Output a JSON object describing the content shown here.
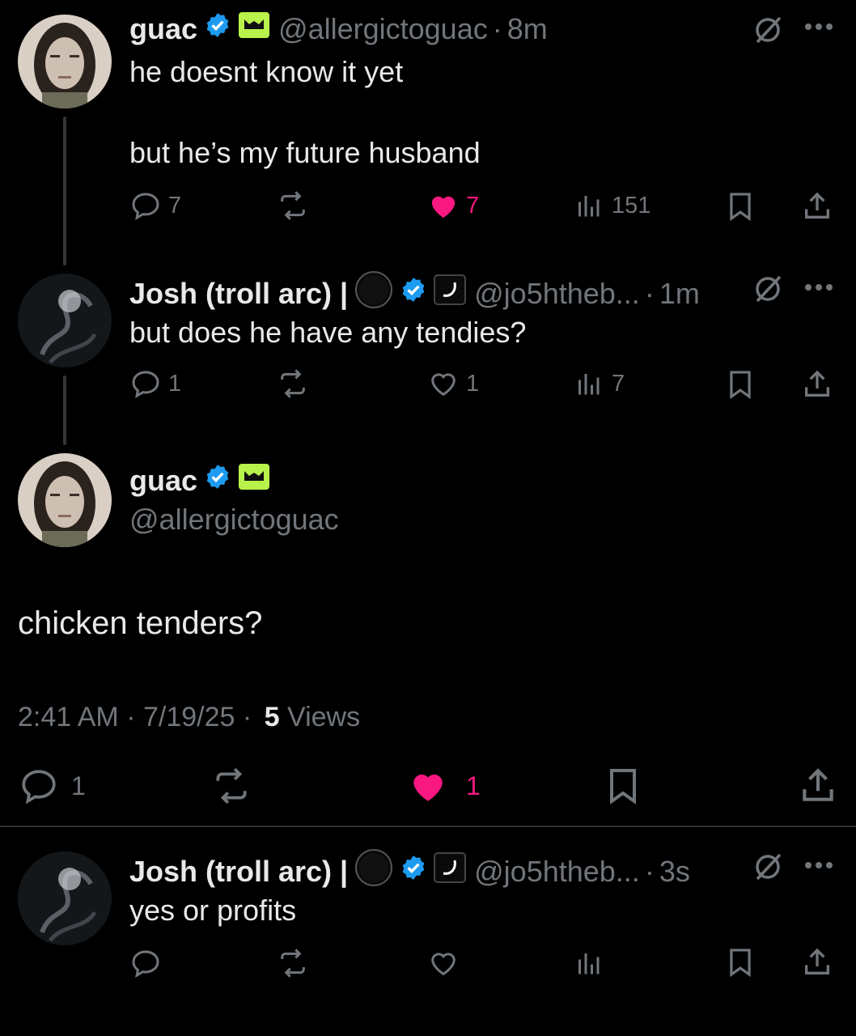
{
  "tweets": [
    {
      "name": "guac",
      "handle": "@allergictoguac",
      "time": "8m",
      "text": "he doesnt know it yet\n\nbut he’s my future husband",
      "replies": "7",
      "likes": "7",
      "views": "151",
      "liked": true
    },
    {
      "name": "Josh (troll arc) |",
      "handle": "@jo5htheb...",
      "time": "1m",
      "text": "but does he have any tendies?",
      "replies": "1",
      "likes": "1",
      "views": "7",
      "liked": false
    }
  ],
  "main": {
    "name": "guac",
    "handle": "@allergictoguac",
    "text": "chicken tenders?",
    "timestamp": "2:41 AM · 7/19/25 ·",
    "views_count": "5",
    "views_label": "Views",
    "replies": "1",
    "likes": "1"
  },
  "reply": {
    "name": "Josh (troll arc) |",
    "handle": "@jo5htheb...",
    "time": "3s",
    "text": "yes or profits"
  },
  "colors": {
    "background": "#000000",
    "text": "#e7e9ea",
    "muted": "#71767b",
    "like": "#f91880",
    "verified": "#1d9bf0",
    "affiliate": "#b8f24a"
  }
}
